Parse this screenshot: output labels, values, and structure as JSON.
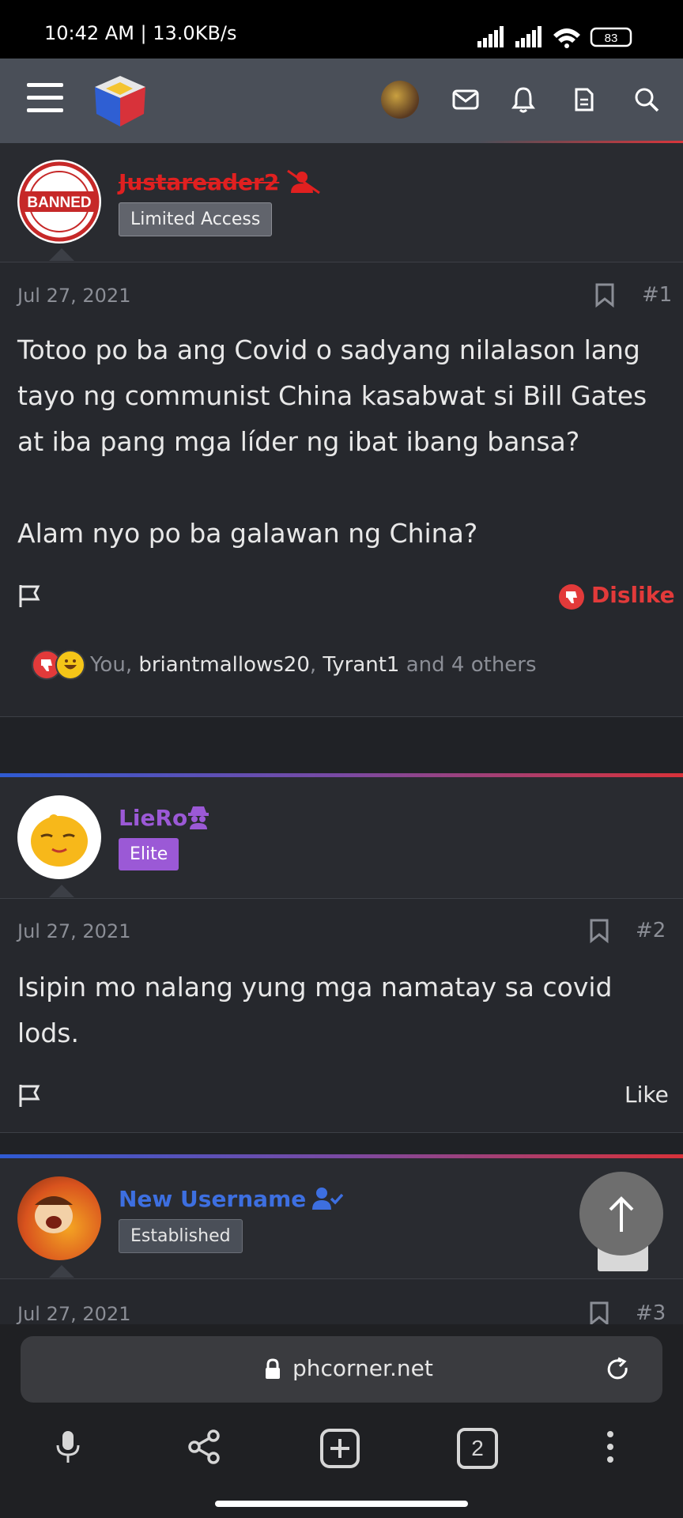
{
  "status_bar": {
    "time": "10:42 AM | 13.0KB/s",
    "battery": "83"
  },
  "nav": {
    "menu_icon": "hamburger-icon",
    "logo": "site-logo",
    "icons": [
      "avatar",
      "mail-icon",
      "bell-icon",
      "document-icon",
      "search-icon"
    ]
  },
  "posts": [
    {
      "username": "Justareader2",
      "user_badge": "Limited Access",
      "avatar_text": "BANNED",
      "date": "Jul 27, 2021",
      "number": "#1",
      "body": [
        "Totoo po ba ang Covid o sadyang nilalason lang",
        "tayo ng communist China kasabwat si Bill Gates",
        "at iba pang mga líder ng ibat ibang bansa?",
        "",
        "Alam nyo po ba galawan ng China?"
      ],
      "reaction_label": "Dislike",
      "reactions": {
        "you": "You, ",
        "user1": "briantmallows20",
        "comma": ", ",
        "user2": "Tyrant1",
        "others": " and 4 others"
      }
    },
    {
      "username": "LieRo",
      "user_badge": "Elite",
      "date": "Jul 27, 2021",
      "number": "#2",
      "body": [
        "Isipin mo nalang yung mga namatay sa covid",
        "lods."
      ],
      "reaction_label": "Like"
    },
    {
      "username": "New Username",
      "user_badge": "Established",
      "date": "Jul 27, 2021",
      "number": "#3"
    }
  ],
  "browser": {
    "url": "phcorner.net",
    "tab_count": "2"
  },
  "colors": {
    "banned": "#e02020",
    "elite": "#9b59d6",
    "established": "#3d6fe0",
    "dislike": "#e23a3a"
  }
}
